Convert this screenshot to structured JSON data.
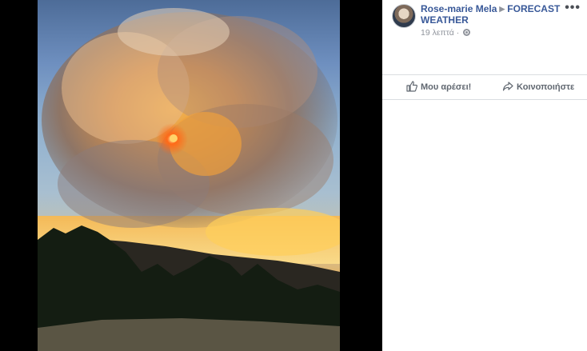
{
  "post": {
    "author": "Rose-marie Mela",
    "target_page": "FORECAST WEATHER",
    "time": "19 λεπτά",
    "privacy_icon": "globe-icon",
    "menu_icon": "more-options-icon",
    "photo_subject": ""
  },
  "actions": {
    "like_label": "Μου αρέσει!",
    "share_label": "Κοινοποιήστε",
    "like_icon": "thumbs-up-icon",
    "share_icon": "share-arrow-icon"
  },
  "colors": {
    "link": "#385898",
    "secondary": "#90949c",
    "divider": "#dadde1"
  }
}
